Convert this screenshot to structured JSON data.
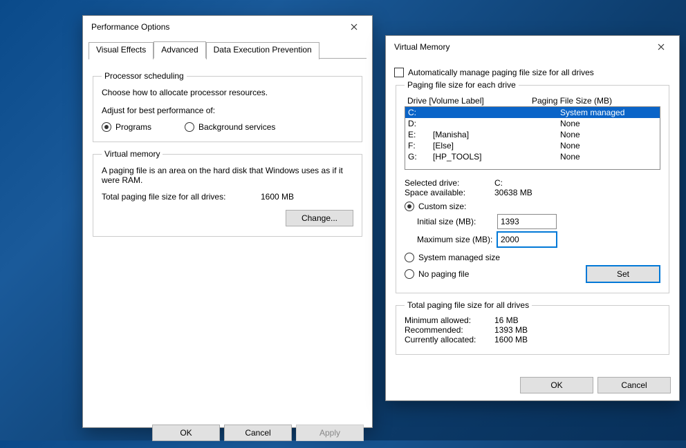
{
  "perf": {
    "title": "Performance Options",
    "tabs": [
      "Visual Effects",
      "Advanced",
      "Data Execution Prevention"
    ],
    "groupProcessor": {
      "legend": "Processor scheduling",
      "desc": "Choose how to allocate processor resources.",
      "label": "Adjust for best performance of:",
      "optPrograms": "Programs",
      "optBackground": "Background services"
    },
    "groupVM": {
      "legend": "Virtual memory",
      "desc": "A paging file is an area on the hard disk that Windows uses as if it were RAM.",
      "totalLabel": "Total paging file size for all drives:",
      "totalValue": "1600 MB",
      "change": "Change..."
    },
    "footer": {
      "ok": "OK",
      "cancel": "Cancel",
      "apply": "Apply"
    }
  },
  "vm": {
    "title": "Virtual Memory",
    "autoManage": "Automatically manage paging file size for all drives",
    "groupDrives": {
      "legend": "Paging file size for each drive",
      "hdrDrive": "Drive  [Volume Label]",
      "hdrSize": "Paging File Size (MB)",
      "rows": [
        {
          "letter": "C:",
          "label": "",
          "size": "System managed",
          "sel": true
        },
        {
          "letter": "D:",
          "label": "",
          "size": "None"
        },
        {
          "letter": "E:",
          "label": "[Manisha]",
          "size": "None"
        },
        {
          "letter": "F:",
          "label": "[Else]",
          "size": "None"
        },
        {
          "letter": "G:",
          "label": "[HP_TOOLS]",
          "size": "None"
        }
      ],
      "selDriveLabel": "Selected drive:",
      "selDrive": "C:",
      "spaceLabel": "Space available:",
      "space": "30638 MB",
      "optCustom": "Custom size:",
      "initialLabel": "Initial size (MB):",
      "initialValue": "1393",
      "maxLabel": "Maximum size (MB):",
      "maxValue": "2000",
      "optSystem": "System managed size",
      "optNone": "No paging file",
      "set": "Set"
    },
    "groupTotal": {
      "legend": "Total paging file size for all drives",
      "minLabel": "Minimum allowed:",
      "min": "16 MB",
      "recLabel": "Recommended:",
      "rec": "1393 MB",
      "curLabel": "Currently allocated:",
      "cur": "1600 MB"
    },
    "footer": {
      "ok": "OK",
      "cancel": "Cancel"
    }
  }
}
